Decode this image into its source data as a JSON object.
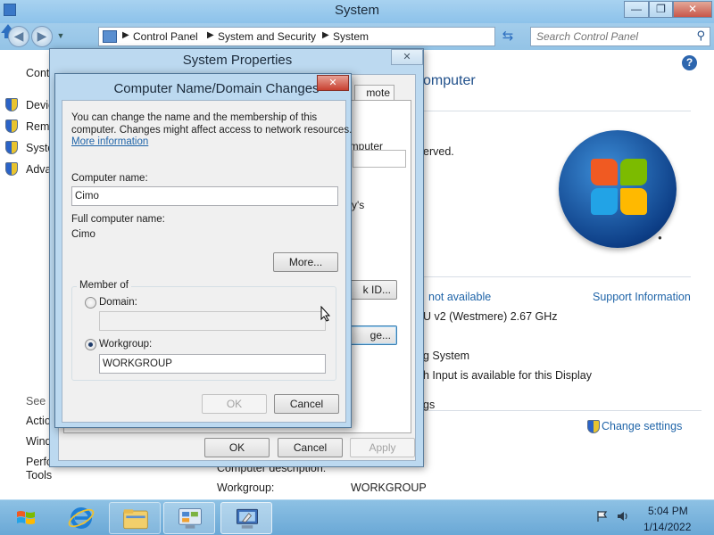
{
  "window": {
    "title": "System",
    "minimize_glyph": "—",
    "maximize_glyph": "❐",
    "close_glyph": "✕"
  },
  "address": {
    "crumbs": [
      "Control Panel",
      "System and Security",
      "System"
    ],
    "search_placeholder": "Search Control Panel"
  },
  "left_pane": {
    "top_label": "Cont",
    "items": [
      "Devic",
      "Remo",
      "Syste",
      "Adva"
    ],
    "see_also": "See a",
    "bottom_items": [
      "Actio",
      "Wind",
      "Perfo",
      "Tools"
    ]
  },
  "main": {
    "heading": "omputer",
    "reserved": "erved.",
    "not_available": "not available",
    "support_info": "Support Information",
    "processor": "U v2 (Westmere)   2.67 GHz",
    "system_type": "g System",
    "pen_touch": "h Input is available for this Display",
    "settings_header": "gs",
    "change_settings": "Change settings",
    "computer_description_label": "Computer description:",
    "workgroup_label": "Workgroup:",
    "workgroup_value": "WORKGROUP"
  },
  "system_properties": {
    "title": "System Properties",
    "close_glyph": "✕",
    "tab_remote": "mote",
    "fragment_computer": "omputer",
    "fragment_rys": "ry's",
    "network_id_button": "k ID...",
    "change_button": "ge...",
    "ok_button": "OK",
    "cancel_button": "Cancel",
    "apply_button": "Apply"
  },
  "computer_name_dialog": {
    "title": "Computer Name/Domain Changes",
    "close_glyph": "✕",
    "intro_line1": "You can change the name and the membership of this",
    "intro_line2": "computer. Changes might affect access to network resources.",
    "more_info_link": "More information",
    "computer_name_label": "Computer name:",
    "computer_name_value": "Cimo",
    "full_name_label": "Full computer name:",
    "full_name_value": "Cimo",
    "more_button": "More...",
    "member_of_label": "Member of",
    "domain_label": "Domain:",
    "domain_value": "",
    "workgroup_label": "Workgroup:",
    "workgroup_value": "WORKGROUP",
    "selected_membership": "workgroup",
    "ok_button": "OK",
    "cancel_button": "Cancel"
  },
  "taskbar": {
    "time": "5:04 PM",
    "date": "1/14/2022"
  },
  "colors": {
    "accent": "#1f64a8",
    "title_bar": "#a8d2f0",
    "close_red": "#c84131",
    "taskbar": "#6aa8d6"
  }
}
